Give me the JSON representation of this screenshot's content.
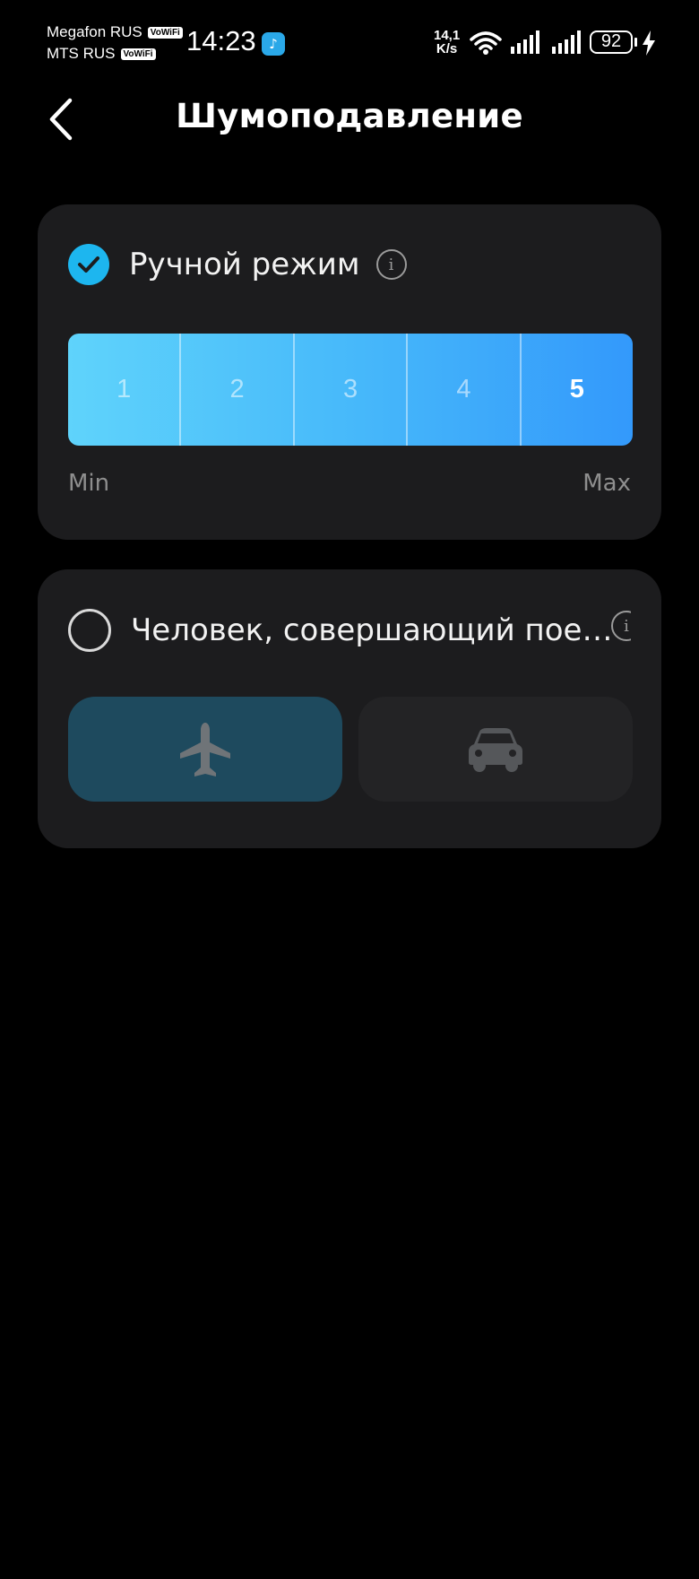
{
  "status_bar": {
    "carrier1": "Megafon RUS",
    "carrier2": "MTS RUS",
    "vowifi": "VoWiFi",
    "time": "14:23",
    "app_icon": "music-app-icon",
    "speed_value": "14,1",
    "speed_unit": "K/s",
    "battery": "92"
  },
  "header": {
    "title": "Шумоподавление"
  },
  "manual_mode": {
    "label": "Ручной режим",
    "checked": true,
    "levels": [
      "1",
      "2",
      "3",
      "4",
      "5"
    ],
    "selected_level": "5",
    "min_label": "Min",
    "max_label": "Max"
  },
  "adaptive_mode": {
    "label": "Человек, совершающий пое…",
    "checked": false,
    "options": [
      {
        "icon": "airplane-icon",
        "active": true
      },
      {
        "icon": "car-icon",
        "active": false
      }
    ]
  },
  "colors": {
    "accent": "#1db6ef",
    "card": "#1c1c1e",
    "gradient_start": "#5fd3fb",
    "gradient_end": "#3399fb"
  }
}
